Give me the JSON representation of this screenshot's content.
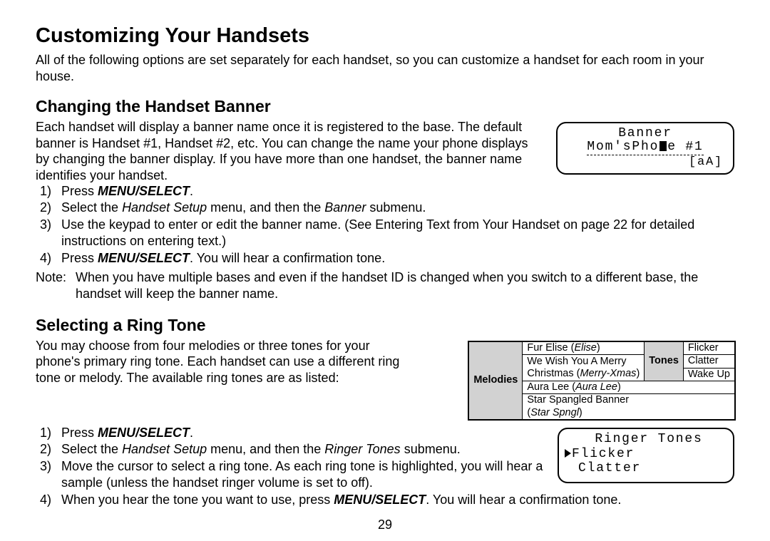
{
  "title": "Customizing Your Handsets",
  "intro": "All of the following options are set separately for each handset, so you can customize a handset for each room in your house.",
  "page_number": "29",
  "banner": {
    "heading": "Changing the Handset Banner",
    "para": "Each handset will display a banner name once it is registered to the base. The default banner is Handset #1, Handset #2, etc. You can change the name your phone displays by changing the banner display. If you have more than one handset, the banner name identifies your handset.",
    "steps_1_pre": "Press ",
    "steps_1_b": "MENU/SELECT",
    "steps_1_post": ".",
    "steps_2_a": "Select the ",
    "steps_2_i1": "Handset Setup",
    "steps_2_b": " menu, and then the ",
    "steps_2_i2": "Banner",
    "steps_2_c": " submenu.",
    "steps_3": "Use the keypad to enter or edit the banner name. (See Entering Text from Your Handset on page 22 for detailed instructions on entering text.)",
    "steps_4_pre": "Press ",
    "steps_4_b": "MENU/SELECT",
    "steps_4_post": ". You will hear a confirmation tone.",
    "note_label": "Note:",
    "note_text": "When you have multiple bases and even if the handset ID is changed when you switch to a different base, the handset will keep the banner name.",
    "lcd_line1": "Banner",
    "lcd_line2_left": "Mom'sPho",
    "lcd_line2_right": "e #1",
    "lcd_line3": "[aA]"
  },
  "ring": {
    "heading": "Selecting a Ring Tone",
    "para": "You may choose from four melodies or three tones for your phone's primary ring tone. Each handset can use a different ring tone or melody. The available ring tones are as listed:",
    "table": {
      "melodies_hdr": "Melodies",
      "tones_hdr": "Tones",
      "m1a": "Fur Elise (",
      "m1i": "Elise",
      "m1b": ")",
      "m2": "We Wish You A Merry",
      "m2b_a": "Christmas (",
      "m2b_i": "Merry-Xmas",
      "m2b_b": ")",
      "m3a": "Aura Lee (",
      "m3i": "Aura Lee",
      "m3b": ")",
      "m4": "Star Spangled Banner",
      "m4b_a": "(",
      "m4b_i": "Star Spngl",
      "m4b_b": ")",
      "t1": "Flicker",
      "t2": "Clatter",
      "t3": "Wake Up"
    },
    "steps_1_pre": "Press ",
    "steps_1_b": "MENU/SELECT",
    "steps_1_post": ".",
    "steps_2_a": "Select the ",
    "steps_2_i1": "Handset Setup",
    "steps_2_b": " menu, and then the ",
    "steps_2_i2": "Ringer Tones",
    "steps_2_c": " submenu.",
    "steps_3": "Move the cursor to select a ring tone. As each ring tone is highlighted, you will hear a sample (unless the handset ringer volume is set to off).",
    "steps_4_pre": "When you hear the tone you want to use, press ",
    "steps_4_b": "MENU/SELECT",
    "steps_4_post": ". You will hear a confirmation tone.",
    "lcd_line1": "Ringer Tones",
    "lcd_line2": "Flicker",
    "lcd_line3": "Clatter"
  }
}
